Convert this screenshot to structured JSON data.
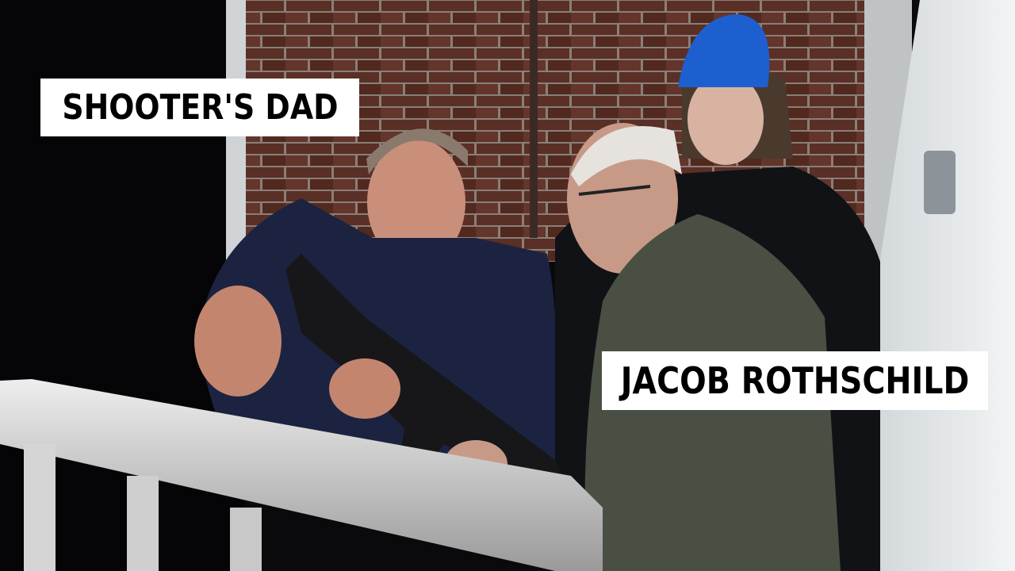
{
  "image": {
    "description_free": true,
    "palette": {
      "brick": "#5a2f26",
      "mortar": "#8a7f78",
      "shirt_navy": "#1c2340",
      "jacket_green": "#4a4f44",
      "cap_blue": "#1e5fd0",
      "railing": "#d9d9d9",
      "skin": "#c98f7a",
      "caption_bg": "#ffffff",
      "caption_text": "#000000"
    }
  },
  "captions": {
    "left_label": "SHOOTER'S DAD",
    "right_label": "JACOB ROTHSCHILD"
  }
}
